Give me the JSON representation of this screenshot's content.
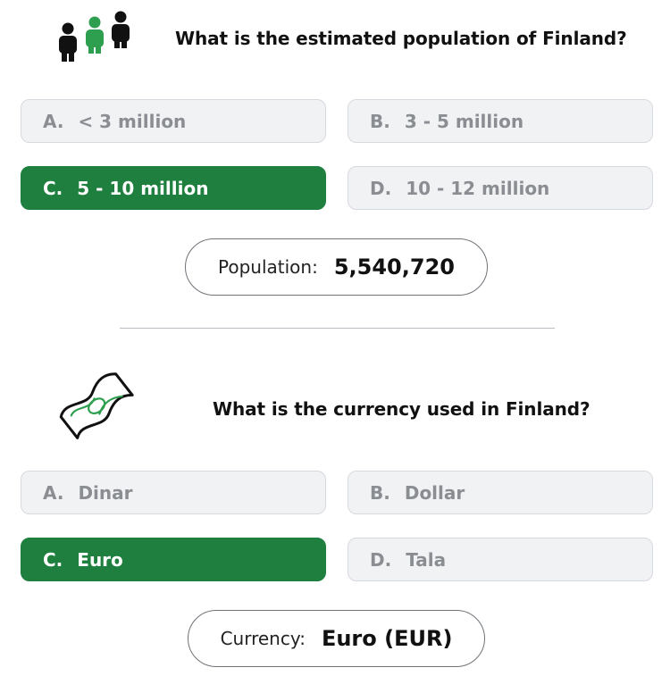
{
  "questions": [
    {
      "icon": "people-icon",
      "text": "What is the estimated population of Finland?",
      "options": [
        {
          "letter": "A.",
          "label": "< 3 million",
          "selected": false
        },
        {
          "letter": "B.",
          "label": "3 - 5 million",
          "selected": false
        },
        {
          "letter": "C.",
          "label": "5 - 10 million",
          "selected": true
        },
        {
          "letter": "D.",
          "label": "10 - 12 million",
          "selected": false
        }
      ],
      "result": {
        "label": "Population:",
        "value": "5,540,720"
      }
    },
    {
      "icon": "banknote-icon",
      "text": "What is the currency used in Finland?",
      "options": [
        {
          "letter": "A.",
          "label": "Dinar",
          "selected": false
        },
        {
          "letter": "B.",
          "label": "Dollar",
          "selected": false
        },
        {
          "letter": "C.",
          "label": "Euro",
          "selected": true
        },
        {
          "letter": "D.",
          "label": "Tala",
          "selected": false
        }
      ],
      "result": {
        "label": "Currency:",
        "value": "Euro (EUR)"
      }
    }
  ],
  "colors": {
    "selected_bg": "#1e7f3e",
    "option_bg": "#f1f2f4",
    "option_text": "#8a8d92",
    "icon_accent": "#2e9e4f"
  }
}
